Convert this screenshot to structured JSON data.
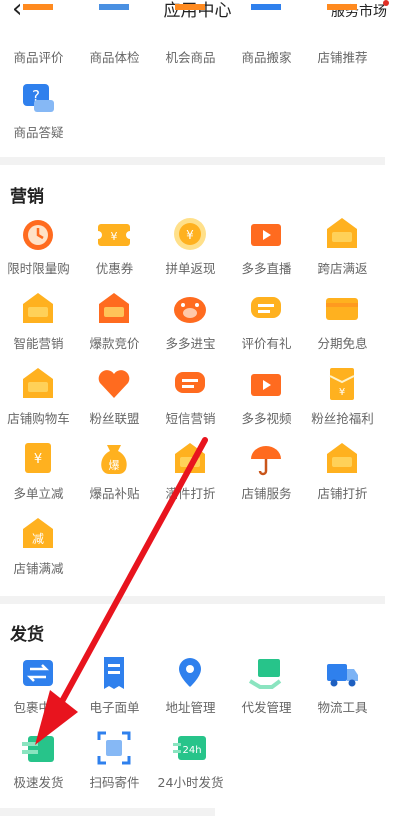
{
  "header": {
    "back_icon": "chevron-left-icon",
    "title": "应用中心",
    "market_label": "服务市场"
  },
  "top_partial": {
    "items": [
      {
        "label": "商品评价",
        "icon": "review-icon",
        "color": "#ff8a1f"
      },
      {
        "label": "商品体检",
        "icon": "checkup-icon",
        "color": "#4a90e2"
      },
      {
        "label": "机会商品",
        "icon": "opportunity-icon",
        "color": "#ff8a1f"
      },
      {
        "label": "商品搬家",
        "icon": "move-icon",
        "color": "#2f80ed"
      },
      {
        "label": "店铺推荐",
        "icon": "recommend-icon",
        "color": "#ff8a1f"
      }
    ],
    "extra": {
      "label": "商品答疑",
      "icon": "qa-icon",
      "color": "#2f80ed"
    }
  },
  "marketing": {
    "title": "营销",
    "items": [
      {
        "label": "限时限量购",
        "icon": "clock-icon",
        "color": "#ff6b1f"
      },
      {
        "label": "优惠券",
        "icon": "coupon-icon",
        "color": "#ffb11f"
      },
      {
        "label": "拼单返现",
        "icon": "coin-icon",
        "color": "#ffb11f"
      },
      {
        "label": "多多直播",
        "icon": "live-icon",
        "color": "#ff6b1f"
      },
      {
        "label": "跨店满返",
        "icon": "tag-icon",
        "color": "#ffb11f"
      },
      {
        "label": "智能营销",
        "icon": "chart-bag-icon",
        "color": "#ffb11f"
      },
      {
        "label": "爆款竞价",
        "icon": "bag-icon",
        "color": "#ff6b1f"
      },
      {
        "label": "多多进宝",
        "icon": "pig-icon",
        "color": "#ff6b1f"
      },
      {
        "label": "评价有礼",
        "icon": "message-icon",
        "color": "#ffb11f"
      },
      {
        "label": "分期免息",
        "icon": "card-icon",
        "color": "#ffb11f"
      },
      {
        "label": "店铺购物车",
        "icon": "discount-tag-icon",
        "color": "#ffb11f"
      },
      {
        "label": "粉丝联盟",
        "icon": "heart-icon",
        "color": "#ff6b1f"
      },
      {
        "label": "短信营销",
        "icon": "chat-icon",
        "color": "#ff6b1f"
      },
      {
        "label": "多多视频",
        "icon": "tv-icon",
        "color": "#ff6b1f"
      },
      {
        "label": "粉丝抢福利",
        "icon": "envelope-icon",
        "color": "#ffb11f"
      },
      {
        "label": "多单立减",
        "icon": "yen-doc-icon",
        "color": "#ffb11f"
      },
      {
        "label": "爆品补贴",
        "icon": "money-bag-icon",
        "color": "#ffb11f"
      },
      {
        "label": "满件打折",
        "icon": "gift-bag-icon",
        "color": "#ffb11f"
      },
      {
        "label": "店铺服务",
        "icon": "umbrella-icon",
        "color": "#ff6b1f"
      },
      {
        "label": "店铺打折",
        "icon": "percent-bag-icon",
        "color": "#ffb11f"
      },
      {
        "label": "店铺满减",
        "icon": "minus-tag-icon",
        "color": "#ffb11f"
      }
    ]
  },
  "shipping": {
    "title": "发货",
    "items": [
      {
        "label": "包裹中心",
        "icon": "exchange-icon",
        "color": "#2f80ed"
      },
      {
        "label": "电子面单",
        "icon": "receipt-icon",
        "color": "#2f80ed"
      },
      {
        "label": "地址管理",
        "icon": "location-icon",
        "color": "#2f80ed"
      },
      {
        "label": "代发管理",
        "icon": "box-hand-icon",
        "color": "#27c48a"
      },
      {
        "label": "物流工具",
        "icon": "truck-icon",
        "color": "#2f80ed"
      },
      {
        "label": "极速发货",
        "icon": "fast-ship-icon",
        "color": "#27c48a"
      },
      {
        "label": "扫码寄件",
        "icon": "scan-icon",
        "color": "#2f80ed"
      },
      {
        "label": "24小时发货",
        "icon": "24h-icon",
        "color": "#27c48a"
      }
    ],
    "icon_24h_text": "24h"
  },
  "overlay": {
    "icon": "red-arrow-icon",
    "color": "#e8141e"
  }
}
